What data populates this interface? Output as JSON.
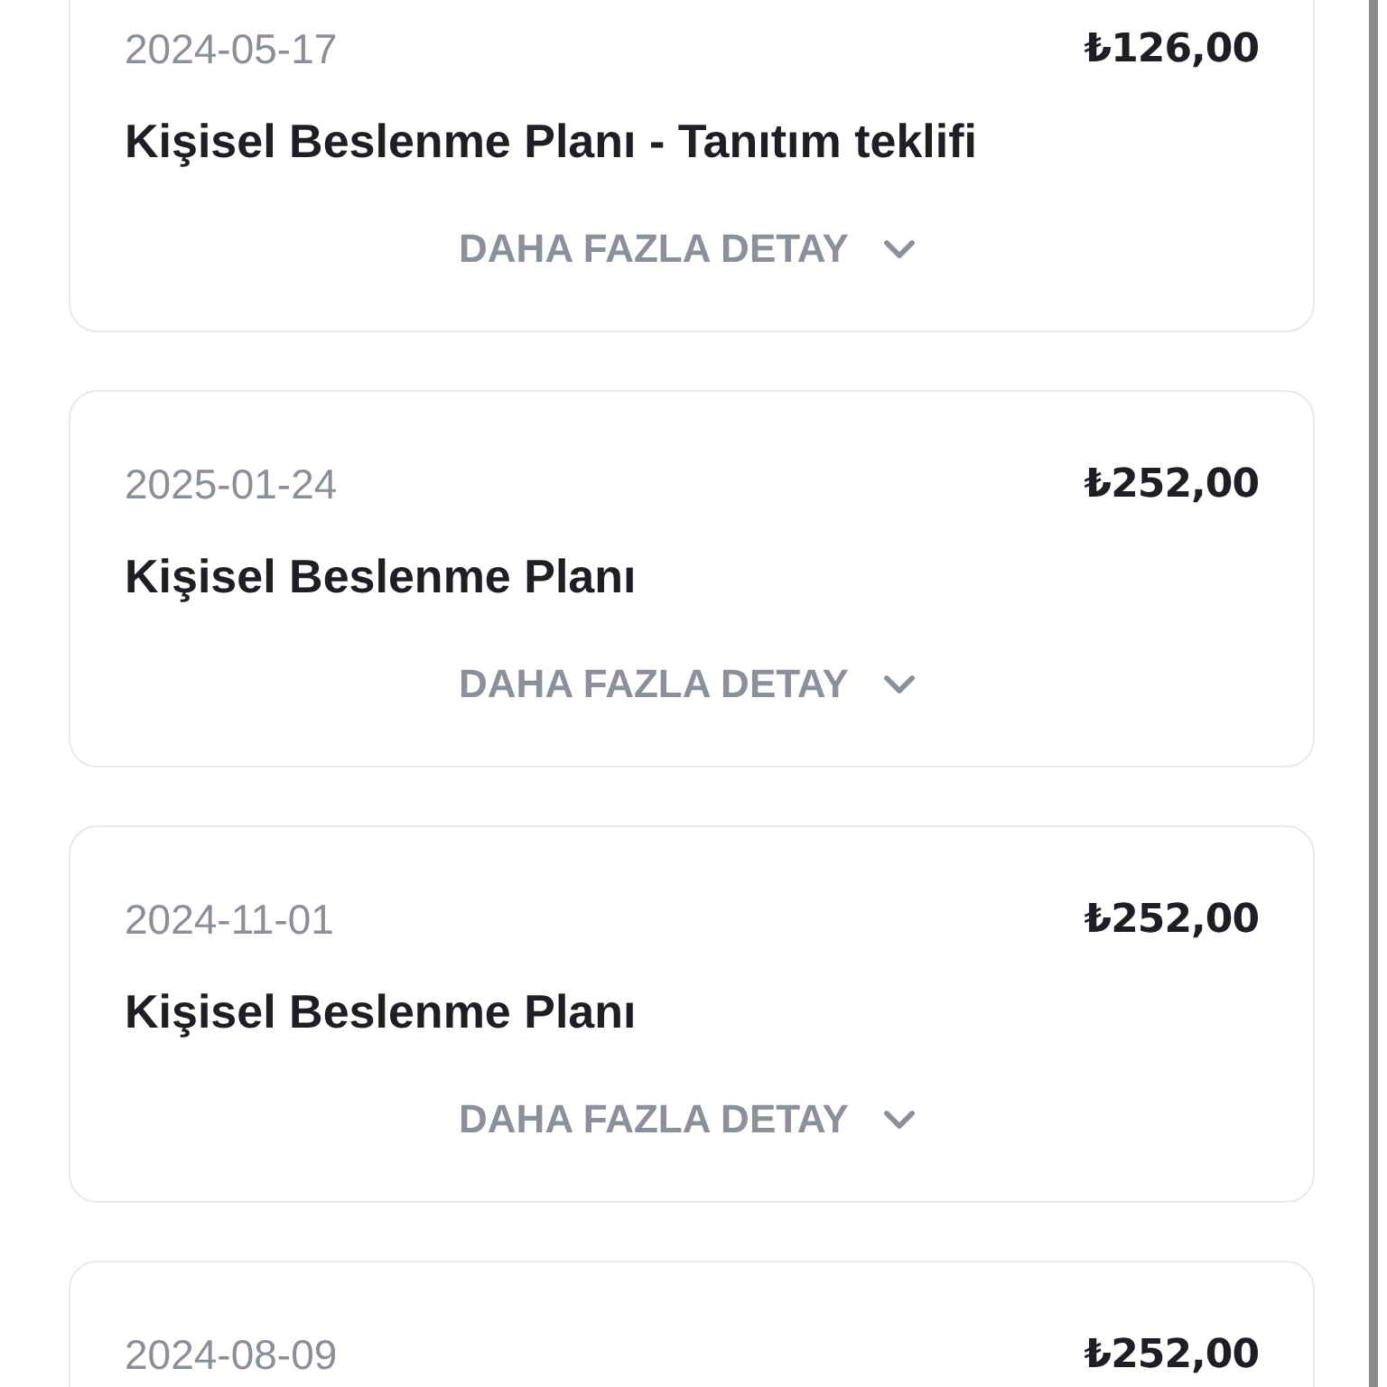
{
  "orders": [
    {
      "date": "2024-05-17",
      "price": "₺126,00",
      "title": "Kişisel Beslenme Planı - Tanıtım teklifi",
      "details_link": "DAHA FAZLA DETAY"
    },
    {
      "date": "2025-01-24",
      "price": "₺252,00",
      "title": "Kişisel Beslenme Planı",
      "details_link": "DAHA FAZLA DETAY"
    },
    {
      "date": "2024-11-01",
      "price": "₺252,00",
      "title": "Kişisel Beslenme Planı",
      "details_link": "DAHA FAZLA DETAY"
    },
    {
      "date": "2024-08-09",
      "price": "₺252,00"
    }
  ]
}
